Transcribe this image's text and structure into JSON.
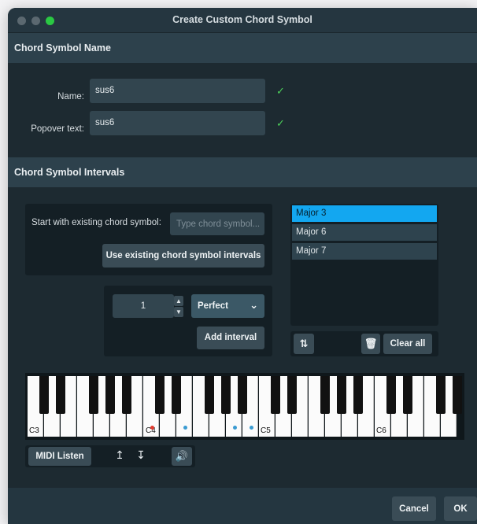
{
  "window": {
    "title": "Create Custom Chord Symbol"
  },
  "name_section": {
    "header": "Chord Symbol Name",
    "name_label": "Name:",
    "name_value": "sus6",
    "popover_label": "Popover text:",
    "popover_value": "sus6"
  },
  "intervals_section": {
    "header": "Chord Symbol Intervals",
    "start_label": "Start with existing chord symbol:",
    "start_placeholder": "Type chord symbol...",
    "use_existing_button": "Use existing chord symbol intervals",
    "interval_number": "1",
    "quality_value": "Perfect",
    "add_interval_button": "Add interval",
    "interval_list": [
      "Major 3",
      "Major 6",
      "Major 7"
    ],
    "clear_all_button": "Clear all"
  },
  "keyboard": {
    "labels": [
      "C3",
      "C4",
      "C5",
      "C6"
    ],
    "midi_listen_button": "MIDI Listen"
  },
  "footer": {
    "cancel_button": "Cancel",
    "ok_button": "OK"
  },
  "colors": {
    "selected_item": "#13a7f0",
    "checkmark": "#4dd15a",
    "root_dot": "#e23b2e",
    "interval_dot": "#3a9bd2"
  },
  "icons": [
    "checkmark-icon",
    "swap-icon",
    "trash-icon",
    "arrow-up-outline-icon",
    "arrow-down-outline-icon",
    "speaker-icon",
    "chevron-down-icon",
    "spinner-up-icon",
    "spinner-down-icon"
  ]
}
